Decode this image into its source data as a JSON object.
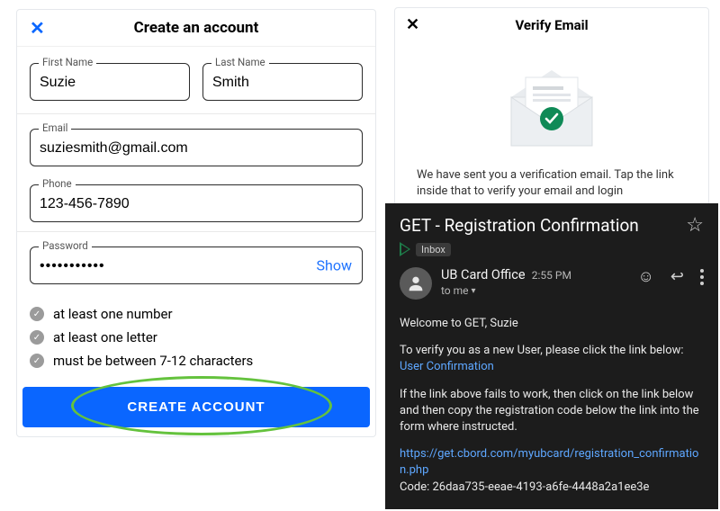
{
  "create": {
    "title": "Create an account",
    "firstNameLabel": "First Name",
    "firstNameValue": "Suzie",
    "lastNameLabel": "Last Name",
    "lastNameValue": "Smith",
    "emailLabel": "Email",
    "emailValue": "suziesmith@gmail.com",
    "phoneLabel": "Phone",
    "phoneValue": "123-456-7890",
    "passwordLabel": "Password",
    "passwordValue": "•••••••••••",
    "showLabel": "Show",
    "reqs": {
      "r1": "at least one number",
      "r2": "at least one letter",
      "r3": "must be between 7-12 characters"
    },
    "buttonLabel": "CREATE ACCOUNT"
  },
  "verify": {
    "title": "Verify Email",
    "text": "We have sent you a verification email. Tap the link inside that to verify your email and login"
  },
  "email": {
    "subject": "GET - Registration Confirmation",
    "inboxLabel": "Inbox",
    "senderName": "UB Card Office",
    "time": "2:55 PM",
    "toMe": "to me",
    "greeting": "Welcome to GET, Suzie",
    "instruction": "To verify you as a new User, please click the link below:",
    "linkText": "User Confirmation",
    "fallback": "If the link above fails to work, then click on the link below and then copy the registration code below the link into the form where instructed.",
    "url": "https://get.cbord.com/myubcard/registration_confirmation.php",
    "code": "Code: 26daa735-eeae-4193-a6fe-4448a2a1ee3e"
  }
}
